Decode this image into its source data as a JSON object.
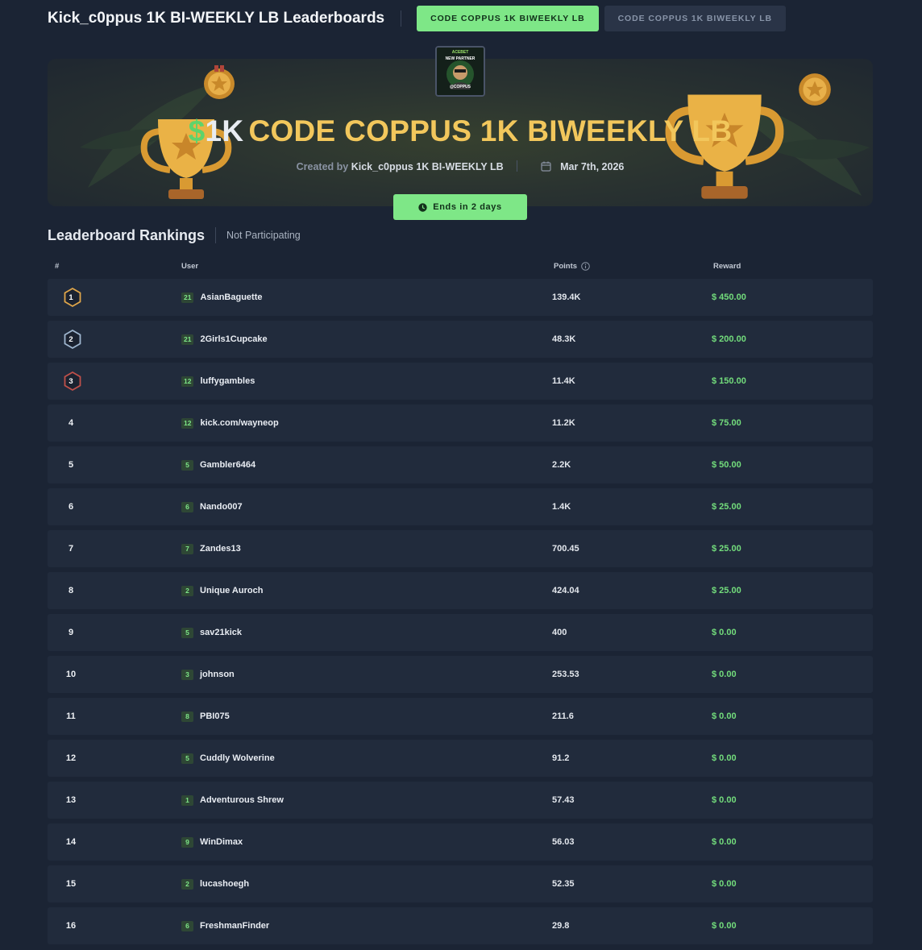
{
  "header": {
    "title": "Kick_c0ppus 1K BI-WEEKLY LB Leaderboards",
    "tabs": [
      {
        "label": "CODE COPPUS 1K BIWEEKLY LB",
        "active": true
      },
      {
        "label": "CODE COPPUS 1K BIWEEKLY LB",
        "active": false
      }
    ]
  },
  "hero": {
    "currency_symbol": "$",
    "amount": "1K",
    "name": "CODE COPPUS 1K BIWEEKLY LB",
    "created_by_label": "Created by",
    "creator": "Kick_c0ppus 1K BI-WEEKLY LB",
    "date": "Mar 7th, 2026",
    "ends_label": "Ends in 2 days",
    "avatar": {
      "line1": "ACEBET",
      "line2": "NEW PARTNER",
      "line3": "@COPPUS"
    }
  },
  "rankings": {
    "title": "Leaderboard Rankings",
    "status": "Not Participating",
    "columns": {
      "rank": "#",
      "user": "User",
      "points": "Points",
      "reward": "Reward"
    },
    "rows": [
      {
        "rank": "1",
        "level": "21",
        "user": "AsianBaguette",
        "points": "139.4K",
        "reward": "$ 450.00"
      },
      {
        "rank": "2",
        "level": "21",
        "user": "2Girls1Cupcake",
        "points": "48.3K",
        "reward": "$ 200.00"
      },
      {
        "rank": "3",
        "level": "12",
        "user": "luffygambles",
        "points": "11.4K",
        "reward": "$ 150.00"
      },
      {
        "rank": "4",
        "level": "12",
        "user": "kick.com/wayneop",
        "points": "11.2K",
        "reward": "$ 75.00"
      },
      {
        "rank": "5",
        "level": "5",
        "user": "Gambler6464",
        "points": "2.2K",
        "reward": "$ 50.00"
      },
      {
        "rank": "6",
        "level": "6",
        "user": "Nando007",
        "points": "1.4K",
        "reward": "$ 25.00"
      },
      {
        "rank": "7",
        "level": "7",
        "user": "Zandes13",
        "points": "700.45",
        "reward": "$ 25.00"
      },
      {
        "rank": "8",
        "level": "2",
        "user": "Unique Auroch",
        "points": "424.04",
        "reward": "$ 25.00"
      },
      {
        "rank": "9",
        "level": "5",
        "user": "sav21kick",
        "points": "400",
        "reward": "$ 0.00"
      },
      {
        "rank": "10",
        "level": "3",
        "user": "johnson",
        "points": "253.53",
        "reward": "$ 0.00"
      },
      {
        "rank": "11",
        "level": "8",
        "user": "PBI075",
        "points": "211.6",
        "reward": "$ 0.00"
      },
      {
        "rank": "12",
        "level": "5",
        "user": "Cuddly Wolverine",
        "points": "91.2",
        "reward": "$ 0.00"
      },
      {
        "rank": "13",
        "level": "1",
        "user": "Adventurous Shrew",
        "points": "57.43",
        "reward": "$ 0.00"
      },
      {
        "rank": "14",
        "level": "9",
        "user": "WinDimax",
        "points": "56.03",
        "reward": "$ 0.00"
      },
      {
        "rank": "15",
        "level": "2",
        "user": "lucashoegh",
        "points": "52.35",
        "reward": "$ 0.00"
      },
      {
        "rank": "16",
        "level": "6",
        "user": "FreshmanFinder",
        "points": "29.8",
        "reward": "$ 0.00"
      }
    ]
  },
  "colors": {
    "background": "#1b2434",
    "row": "#212b3c",
    "accent_green": "#7ee787",
    "reward_green": "#73dd7c",
    "gold": "#f2c75c",
    "medal_gold": "#e0a64a",
    "medal_silver": "#9fb6cf",
    "medal_bronze": "#c0504a"
  }
}
